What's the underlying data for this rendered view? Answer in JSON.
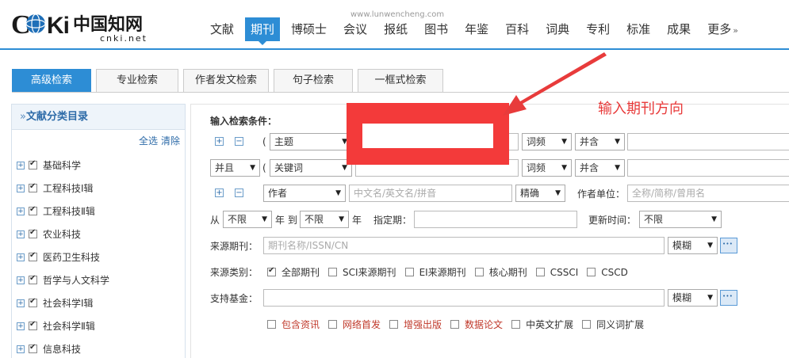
{
  "header": {
    "logo_text": "CNKi",
    "logo_cn": "中国知网",
    "logo_domain": "cnki.net",
    "site_url": "www.lunwencheng.com",
    "nav": [
      "文献",
      "期刊",
      "博硕士",
      "会议",
      "报纸",
      "图书",
      "年鉴",
      "百科",
      "词典",
      "专利",
      "标准",
      "成果",
      "更多"
    ],
    "active_nav_index": 1,
    "more_arrow": "»",
    "accent_color": "#2d8dd5"
  },
  "tabs": [
    "高级检索",
    "专业检索",
    "作者发文检索",
    "句子检索",
    "一框式检索"
  ],
  "sidebar": {
    "title_prefix": "»",
    "title": "文献分类目录",
    "select_all": "全选",
    "clear": "清除",
    "categories": [
      "基础科学",
      "工程科技Ⅰ辑",
      "工程科技Ⅱ辑",
      "农业科技",
      "医药卫生科技",
      "哲学与人文科学",
      "社会科学Ⅰ辑",
      "社会科学Ⅱ辑",
      "信息科技"
    ]
  },
  "form": {
    "heading": "输入检索条件：",
    "row1": {
      "paren": "(",
      "field": "主题",
      "freq": "词频",
      "relation": "并含"
    },
    "row2": {
      "logic": "并且",
      "paren": "(",
      "field": "关键词",
      "freq": "词频",
      "relation": "并含"
    },
    "row3": {
      "field": "作者",
      "author_placeholder": "中文名/英文名/拼音",
      "match": "精确",
      "unit_label": "作者单位：",
      "unit_placeholder": "全称/简称/曾用名"
    },
    "row4": {
      "from": "从",
      "from_val": "不限",
      "year1": "年 到",
      "to_val": "不限",
      "year2": "年",
      "specified": "指定期：",
      "update_label": "更新时间：",
      "update_val": "不限"
    },
    "source": {
      "label": "来源期刊：",
      "placeholder": "期刊名称/ISSN/CN",
      "match": "模糊"
    },
    "category": {
      "label": "来源类别：",
      "options": [
        "全部期刊",
        "SCI来源期刊",
        "EI来源期刊",
        "核心期刊",
        "CSSCI",
        "CSCD"
      ]
    },
    "fund": {
      "label": "支持基金：",
      "match": "模糊"
    },
    "extras": [
      {
        "label": "包含资讯",
        "red": true
      },
      {
        "label": "网络首发",
        "red": true
      },
      {
        "label": "增强出版",
        "red": true
      },
      {
        "label": "数据论文",
        "red": true
      },
      {
        "label": "中英文扩展",
        "red": false
      },
      {
        "label": "同义词扩展",
        "red": false
      }
    ]
  },
  "annotation": {
    "text": "输入期刊方向",
    "color": "#e83b3b"
  }
}
